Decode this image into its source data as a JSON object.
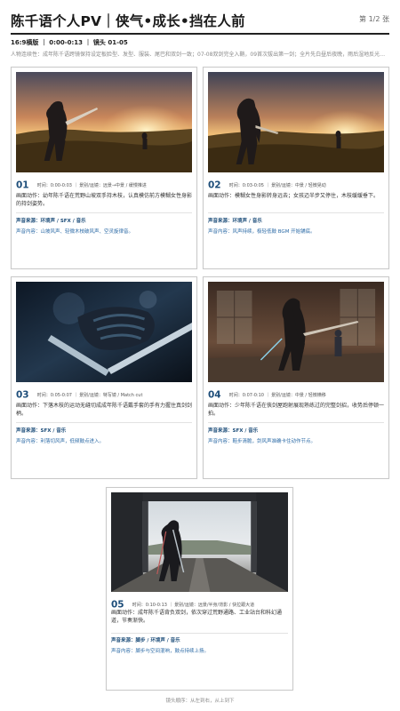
{
  "header": {
    "title": "陈千语个人PV｜侠气•成长•挡在人前",
    "page": "第 1/2 张"
  },
  "meta": "16:9横版 ｜ 0:00-0:13 ｜ 镜头 01-05",
  "continuity": "人物连续性：成年陈千语跨镜保持设定板脸型、发型、服装、尾巴和双剑一致；07-08双剑完全入鞘，09首次拔出第一剑；全片先白昼后夜晚，雨后湿地反光统一。",
  "shots": [
    {
      "num": "01",
      "info": "时间：0:00-0:03 ｜ 景别/运镜：远景→中景 / 缓慢推进",
      "action": "画面动作：幼年陈千语在荒野山坡双手持木枝，认真模仿前方模糊女性身影的持剑姿势。",
      "sound_src": "声音来源：环境声 / SFX / 音乐",
      "sound_content": "声音内容：山坡风声、轻微木枝破风声、空灵旋律音。"
    },
    {
      "num": "02",
      "info": "时间：0:03-0:05 ｜ 景别/运镜：中景 / 轻微晃动",
      "action": "画面动作：模糊女性身影转身远去；女孩迈半步又停住，木枝缓缓垂下。",
      "sound_src": "声音来源：环境声 / 音乐",
      "sound_content": "声音内容：风声持续，极轻低鼓 BGM 开始铺底。"
    },
    {
      "num": "03",
      "info": "时间：0:05-0:07 ｜ 景别/运镜：特写镜 / Match cut",
      "action": "画面动作：下落木枝的运动无缝切成成年陈千语戴手套的手有力握住真剑剑柄。",
      "sound_src": "声音来源：SFX / 音乐",
      "sound_content": "声音内容：利落切风声，低频鼓点进入。"
    },
    {
      "num": "04",
      "info": "时间：0:07-0:10 ｜ 景别/运镜：中景 / 轻微横移",
      "action": "画面动作：少年陈千语在俠剑屋跑射展现熟练过的完整剑招，收势后停顿一拍。",
      "sound_src": "声音来源：SFX / 音乐",
      "sound_content": "声音内容：鞋步清脆，剑风声准确卡住动作节点。"
    },
    {
      "num": "05",
      "info": "时间：0:10-0:13 ｜ 景别/运镜：远景/半身/背影 / 快拉跟大道",
      "action": "画面动作：成年陈千语背负双剑，依次穿过荒野通路、工业站台和科幻通道，节奏渐快。",
      "sound_src": "声音来源：脚步 / 环境声 / 音乐",
      "sound_content": "声音内容：脚步与空间混响，鼓点持续上扬。"
    }
  ],
  "footer": "镜头顺序：从左到右，从上到下",
  "colors": {
    "accent": "#1e4e7a",
    "sound_text": "#2b6aa6",
    "border": "#c9c9c9"
  }
}
